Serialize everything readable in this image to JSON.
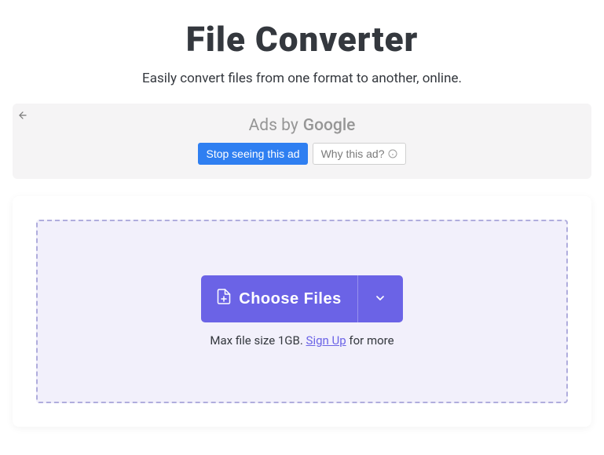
{
  "header": {
    "title": "File Converter",
    "subtitle": "Easily convert files from one format to another, online."
  },
  "ad": {
    "prefix": "Ads by",
    "brand": "Google",
    "stop_label": "Stop seeing this ad",
    "why_label": "Why this ad?"
  },
  "dropzone": {
    "choose_label": "Choose Files",
    "filesize_prefix": "Max file size 1GB. ",
    "signup_label": "Sign Up",
    "filesize_suffix": " for more"
  }
}
